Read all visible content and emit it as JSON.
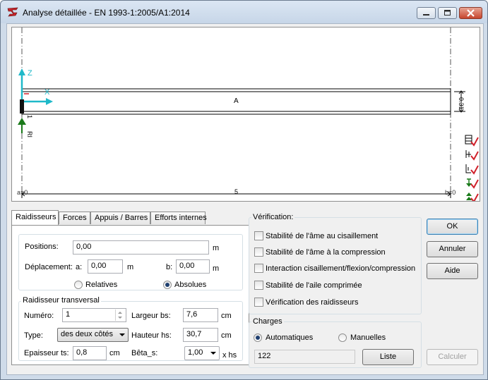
{
  "window": {
    "title": "Analyse détaillée - EN 1993-1:2005/A1:2014"
  },
  "drawing": {
    "z_label": "Z",
    "x_label": "X",
    "beam_label": "A",
    "height_dim": "0.31",
    "support_num": "1",
    "support_label": "RI",
    "left_marker": "a=0",
    "length_label": "5",
    "right_marker": "b=0",
    "side_icons": [
      "stiffener-check-icon",
      "stiffener-check-icon",
      "stiffener-check-icon",
      "load-down-check-icon",
      "load-up-check-icon"
    ]
  },
  "tabs": [
    "Raidisseurs",
    "Forces",
    "Appuis / Barres",
    "Efforts internes"
  ],
  "raidisseurs": {
    "positions_label": "Positions:",
    "positions_value": "0,00",
    "positions_unit": "m",
    "deplacement_label": "Déplacement:",
    "a_label": "a:",
    "a_value": "0,00",
    "a_unit": "m",
    "b_label": "b:",
    "b_value": "0,00",
    "b_unit": "m",
    "relatives_label": "Relatives",
    "absolues_label": "Absolues",
    "selected_mode": "Absolues",
    "transversal_title": "Raidisseur transversal",
    "numero_label": "Numéro:",
    "numero_value": "1",
    "largeur_label": "Largeur bs:",
    "largeur_value": "7,6",
    "largeur_unit": "cm",
    "type_label": "Type:",
    "type_value": "des deux côtés",
    "hauteur_label": "Hauteur hs:",
    "hauteur_value": "30,7",
    "hauteur_unit": "cm",
    "epaisseur_label": "Epaisseur ts:",
    "epaisseur_value": "0,8",
    "epaisseur_unit": "cm",
    "beta_label": "Bêta_s:",
    "beta_value": "1,00",
    "beta_unit": "x  hs"
  },
  "verification": {
    "title": "Vérification:",
    "items": [
      "Stabilité de l'âme au cisaillement",
      "Stabilité de l'âme à la compression",
      "Interaction cisaillement/flexion/compression",
      "Stabilité de l'aile comprimée",
      "Vérification des raidisseurs"
    ]
  },
  "charges": {
    "title": "Charges",
    "automatiques_label": "Automatiques",
    "manuelles_label": "Manuelles",
    "selected": "Automatiques",
    "value": "122",
    "liste_label": "Liste"
  },
  "buttons": {
    "ok": "OK",
    "annuler": "Annuler",
    "aide": "Aide",
    "calculer": "Calculer"
  },
  "colors": {
    "axis": "#1fb9c9",
    "support": "#1a7a1a",
    "check": "#d0202a"
  }
}
